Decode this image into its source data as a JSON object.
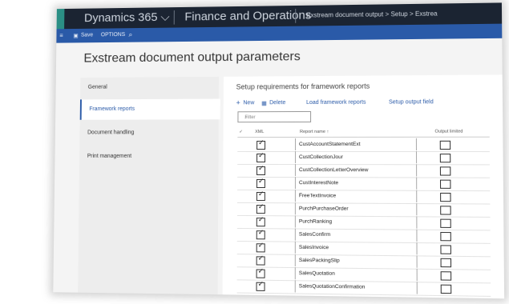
{
  "navbar": {
    "app_name": "Dynamics 365 ⌵",
    "module_name": "Finance and Operations",
    "breadcrumb": "Exstream document output  >  Setup  >  Exstrea"
  },
  "actionbar": {
    "save_label": "Save",
    "options_label": "OPTIONS"
  },
  "page": {
    "title": "Exstream document output parameters"
  },
  "leftnav": {
    "items": [
      {
        "label": "General",
        "selected": false
      },
      {
        "label": "Framework reports",
        "selected": true
      },
      {
        "label": "Document handling",
        "selected": false
      },
      {
        "label": "Print management",
        "selected": false
      }
    ]
  },
  "main": {
    "subtitle": "Setup requirements for framework reports",
    "toolbar": {
      "new_label": "New",
      "delete_label": "Delete",
      "load_label": "Load framework reports",
      "setup_label": "Setup output field"
    },
    "filter_placeholder": "Filter",
    "columns": {
      "check": "✓",
      "xml": "XML",
      "report_name": "Report name ↑",
      "output_limited": "Output limited"
    },
    "rows": [
      {
        "report_name": "CustAccountStatementExt",
        "xml": true,
        "output_limited": false
      },
      {
        "report_name": "CustCollectionJour",
        "xml": true,
        "output_limited": false
      },
      {
        "report_name": "CustCollectionLetterOverview",
        "xml": true,
        "output_limited": false
      },
      {
        "report_name": "CustInterestNote",
        "xml": true,
        "output_limited": false
      },
      {
        "report_name": "FreeTextInvoice",
        "xml": true,
        "output_limited": false
      },
      {
        "report_name": "PurchPurchaseOrder",
        "xml": true,
        "output_limited": false
      },
      {
        "report_name": "PurchRanking",
        "xml": true,
        "output_limited": false
      },
      {
        "report_name": "SalesConfirm",
        "xml": true,
        "output_limited": false
      },
      {
        "report_name": "SalesInvoice",
        "xml": true,
        "output_limited": false
      },
      {
        "report_name": "SalesPackingSlip",
        "xml": true,
        "output_limited": false
      },
      {
        "report_name": "SalesQuotation",
        "xml": true,
        "output_limited": false
      },
      {
        "report_name": "SalesQuotationConfirmation",
        "xml": true,
        "output_limited": false
      }
    ]
  },
  "colors": {
    "navbar": "#1b2432",
    "actionbar": "#2a5aa8",
    "accent": "#2b8f85"
  }
}
